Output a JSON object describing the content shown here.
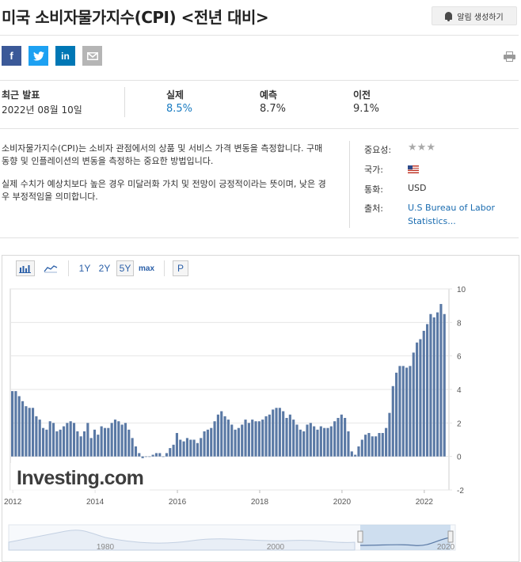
{
  "header": {
    "title": "미국 소비자물가지수(CPI) <전년 대비>",
    "alert_button": "알림 생성하기"
  },
  "share": {
    "facebook": "f",
    "linkedin": "in"
  },
  "stats": {
    "recent_label": "최근 발표",
    "recent_date": "2022년 08월 10일",
    "actual_label": "실제",
    "actual_value": "8.5%",
    "forecast_label": "예측",
    "forecast_value": "8.7%",
    "previous_label": "이전",
    "previous_value": "9.1%"
  },
  "description": {
    "p1": "소비자물가지수(CPI)는 소비자 관점에서의 상품 및 서비스 가격 변동을 측정합니다. 구매 동향 및 인플레이션의 변동을 측정하는 중요한 방법입니다.",
    "p2": "실제 수치가 예상치보다 높은 경우 미달러화 가치 및 전망이 긍정적이라는 뜻이며, 낮은 경우 부정적임을 의미합니다."
  },
  "meta": {
    "importance_label": "중요성:",
    "importance_stars": 3,
    "country_label": "국가:",
    "currency_label": "통화:",
    "currency_value": "USD",
    "source_label": "출처:",
    "source_value": "U.S Bureau of Labor Statistics..."
  },
  "toolbar": {
    "range_1y": "1Y",
    "range_2y": "2Y",
    "range_5y": "5Y",
    "range_max": "max",
    "p_button": "P",
    "active_range": "5Y"
  },
  "colors": {
    "bar": "#5a79a5",
    "accent": "#1a7cc2",
    "navigator_fill": "#bcd3ea"
  },
  "chart_data": {
    "type": "bar",
    "watermark": "Investing.com",
    "ylim": [
      -2,
      10
    ],
    "y_ticks": [
      "10",
      "8",
      "6",
      "4",
      "2",
      "0",
      "-2"
    ],
    "x_ticks": [
      "2012",
      "2014",
      "2016",
      "2018",
      "2020",
      "2022"
    ],
    "navigator_ticks": [
      "1980",
      "2000",
      "2020"
    ],
    "series": [
      {
        "values": [
          3.9,
          3.9,
          3.6,
          3.3,
          3.0,
          2.9,
          2.9,
          2.4,
          2.2,
          1.7,
          1.6,
          2.1,
          2.0,
          1.5,
          1.6,
          1.8,
          2.0,
          2.1,
          2.0,
          1.5,
          1.2,
          1.5,
          2.0,
          1.1,
          1.6,
          1.3,
          1.8,
          1.7,
          1.7,
          2.0,
          2.2,
          2.1,
          1.9,
          2.0,
          1.6,
          1.1,
          0.6,
          0.2,
          -0.1,
          0.0,
          0.0,
          0.1,
          0.2,
          0.2,
          0.0,
          0.2,
          0.5,
          0.7,
          1.4,
          1.0,
          0.9,
          1.1,
          1.0,
          1.0,
          0.8,
          1.1,
          1.5,
          1.6,
          1.7,
          2.1,
          2.5,
          2.7,
          2.4,
          2.2,
          1.9,
          1.6,
          1.7,
          1.9,
          2.2,
          2.0,
          2.2,
          2.1,
          2.1,
          2.2,
          2.4,
          2.5,
          2.8,
          2.9,
          2.9,
          2.7,
          2.3,
          2.5,
          2.2,
          1.9,
          1.6,
          1.5,
          1.9,
          2.0,
          1.8,
          1.6,
          1.8,
          1.7,
          1.7,
          1.8,
          2.1,
          2.3,
          2.5,
          2.3,
          1.5,
          0.3,
          0.1,
          0.6,
          1.0,
          1.3,
          1.4,
          1.2,
          1.2,
          1.4,
          1.4,
          1.7,
          2.6,
          4.2,
          5.0,
          5.4,
          5.4,
          5.3,
          5.4,
          6.2,
          6.8,
          7.0,
          7.5,
          7.9,
          8.5,
          8.3,
          8.6,
          9.1,
          8.5
        ]
      }
    ]
  }
}
